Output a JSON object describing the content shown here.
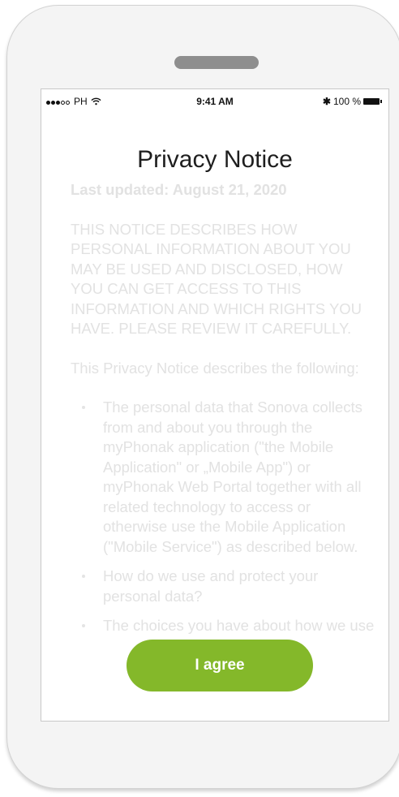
{
  "status_bar": {
    "carrier": "PH",
    "time": "9:41 AM",
    "battery": "100 %"
  },
  "page": {
    "title": "Privacy Notice",
    "last_updated": "Last updated: August 21, 2020",
    "notice": "THIS NOTICE DESCRIBES HOW PERSONAL INFORMATION ABOUT YOU MAY BE USED AND DISCLOSED, HOW YOU CAN GET ACCESS TO THIS INFORMATION AND WHICH RIGHTS YOU HAVE. PLEASE REVIEW IT CAREFULLY.",
    "intro": "This Privacy Notice describes the following:",
    "points": [
      "The personal data that Sonova collects from and about you through the myPhonak application (\"the Mobile Application\" or „Mobile App\") or myPhonak Web Portal together with all related technology to access or otherwise use the Mobile Application (\"Mobile Service\") as described below.",
      "How do we use and protect your personal data?",
      "The choices you have about how we use"
    ]
  },
  "actions": {
    "agree_label": "I agree"
  },
  "colors": {
    "accent": "#84b82a",
    "faded_text": "#e2e2e2"
  }
}
